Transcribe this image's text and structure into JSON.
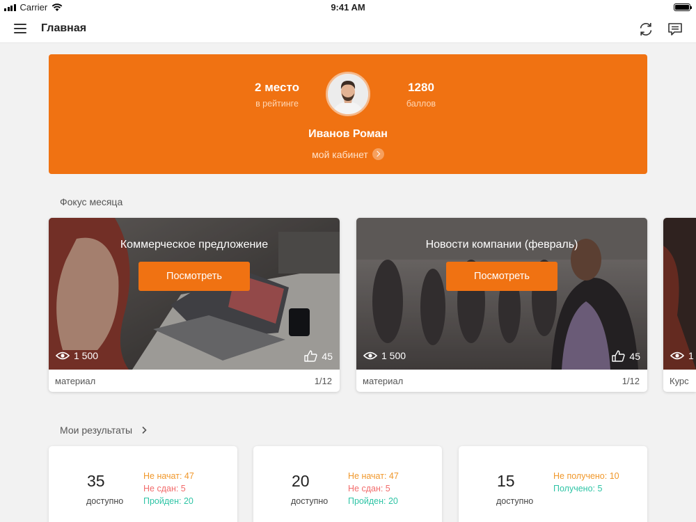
{
  "status_bar": {
    "carrier": "Carrier",
    "time": "9:41 AM"
  },
  "nav": {
    "title": "Главная"
  },
  "profile": {
    "rank_value": "2 место",
    "rank_label": "в рейтинге",
    "points_value": "1280",
    "points_label": "баллов",
    "name": "Иванов Роман",
    "cabinet_link": "мой кабинет"
  },
  "focus": {
    "title": "Фокус месяца",
    "cards": [
      {
        "title": "Коммерческое предложение",
        "button": "Посмотреть",
        "views": "1 500",
        "likes": "45",
        "type": "материал",
        "count": "1/12"
      },
      {
        "title": "Новости компании (февраль)",
        "button": "Посмотреть",
        "views": "1 500",
        "likes": "45",
        "type": "материал",
        "count": "1/12"
      },
      {
        "views": "1",
        "type": "Курс"
      }
    ]
  },
  "results": {
    "title": "Мои результаты",
    "cards": [
      {
        "number": "35",
        "label": "доступно",
        "lines": [
          "Не начат: 47",
          "Не сдан: 5",
          "Пройден: 20"
        ]
      },
      {
        "number": "20",
        "label": "доступно",
        "lines": [
          "Не начат: 47",
          "Не сдан: 5",
          "Пройден: 20"
        ]
      },
      {
        "number": "15",
        "label": "доступно",
        "lines": [
          "Не получено: 10",
          "Получено: 5"
        ]
      }
    ]
  },
  "colors": {
    "accent": "#f07212",
    "status_not_started": "#f0972a",
    "status_failed": "#f26b6b",
    "status_passed": "#2ec4a5"
  },
  "icons": [
    "menu-icon",
    "refresh-icon",
    "chat-icon",
    "eye-icon",
    "thumbs-up-icon",
    "chevron-right-icon",
    "wifi-icon",
    "signal-icon",
    "battery-icon"
  ]
}
